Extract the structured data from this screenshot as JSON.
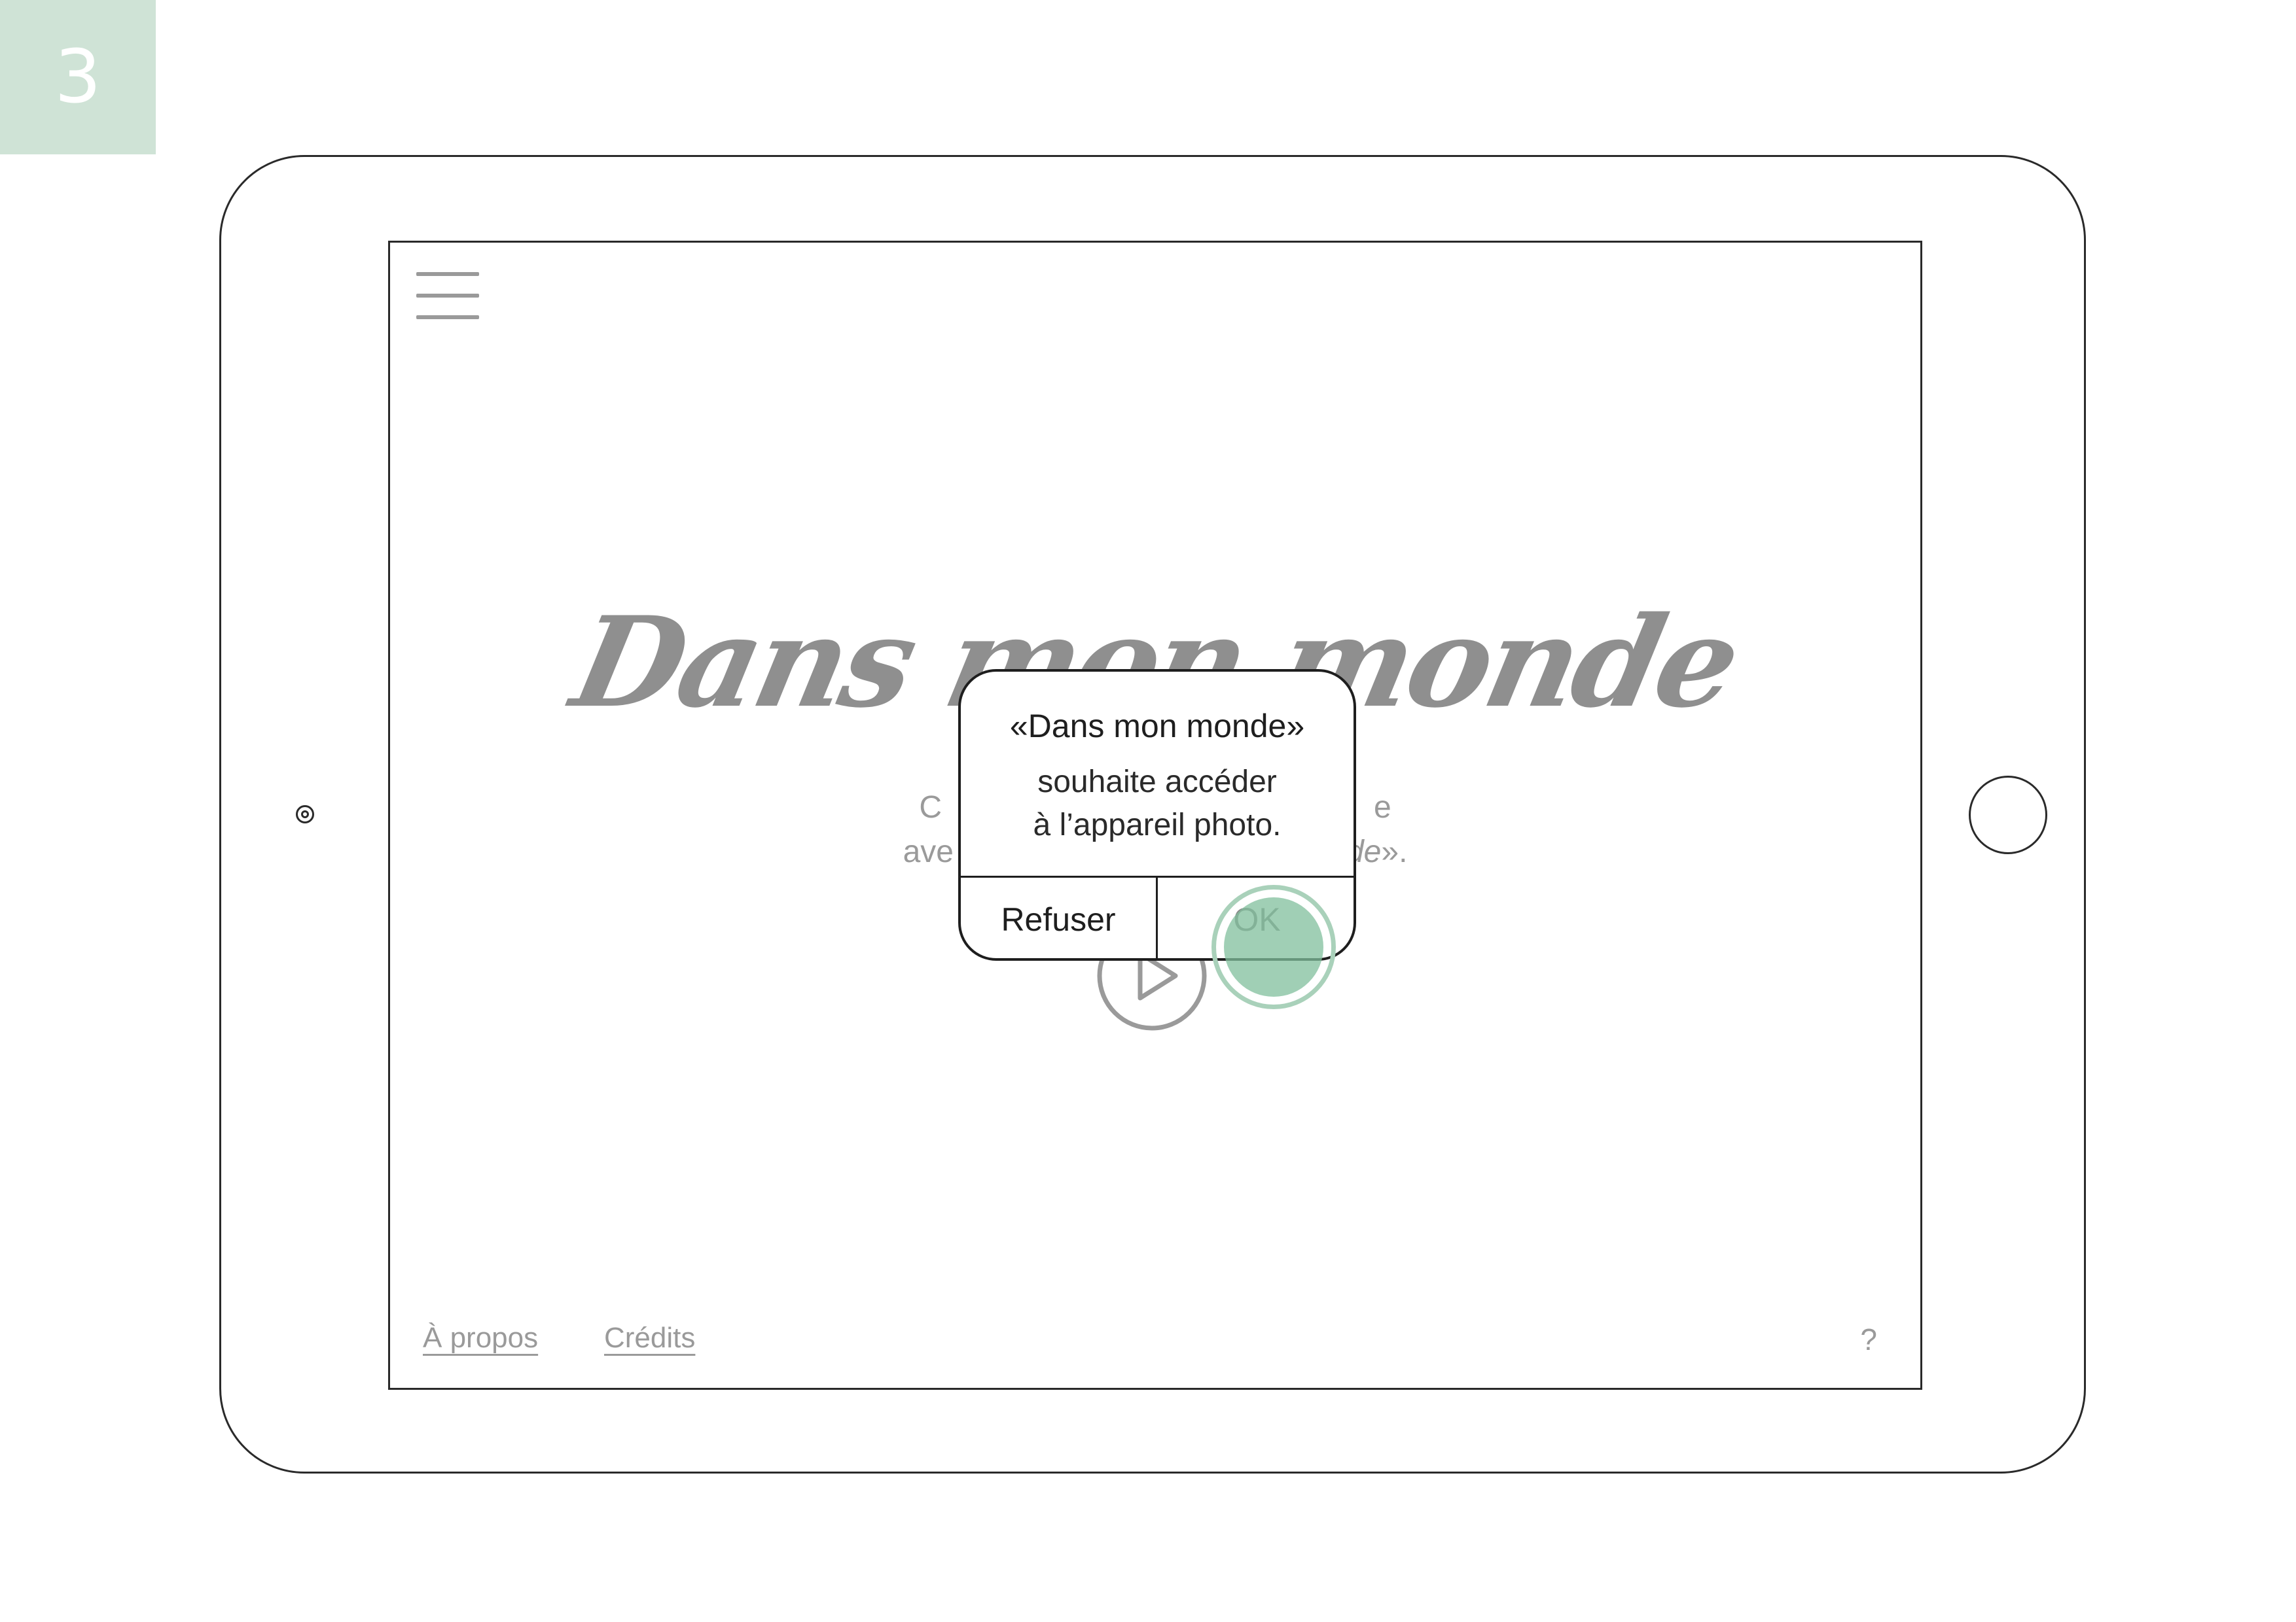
{
  "step": {
    "number": "3"
  },
  "screen": {
    "title": "Dans mon monde",
    "intro": {
      "line1_start": "C",
      "line1_end": "e",
      "line2_start": "ave",
      "line2_end_italic": "de",
      "line2_end": "»."
    },
    "footer": {
      "about_label": "À propos",
      "credits_label": "Crédits",
      "help_label": "?"
    }
  },
  "dialog": {
    "title": "«Dans mon monde»",
    "message_line1": "souhaite accéder",
    "message_line2": "à l’appareil photo.",
    "refuse_label": "Refuser",
    "ok_label": "OK"
  },
  "colors": {
    "accent": "#80bf9c",
    "badge": "#cfe3d6",
    "muted_text": "#9a9a9a",
    "outline": "#2a2a2a"
  },
  "icons": {
    "menu": "hamburger-icon",
    "play": "play-icon",
    "camera": "front-camera-icon",
    "tap": "touch-indicator-icon"
  }
}
